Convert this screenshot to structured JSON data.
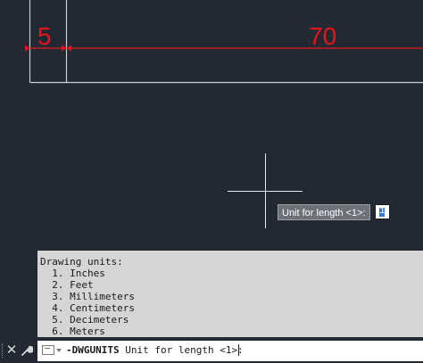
{
  "drawing": {
    "dim_left": "5",
    "dim_right": "70",
    "dim_color": "#e8141c",
    "line_color": "#c8ccd0",
    "background": "#222933"
  },
  "tooltip": {
    "text": "Unit for length <1>:"
  },
  "dynamic_input": {
    "value": "1"
  },
  "history": {
    "lines": [
      "Drawing units:",
      "  1. Inches",
      "  2. Feet",
      "  3. Millimeters",
      "  4. Centimeters",
      "  5. Decimeters",
      "  6. Meters"
    ]
  },
  "command_line": {
    "command": "-DWGUNITS",
    "prompt": " Unit for length <1>: "
  },
  "icons": {
    "close": "close-icon",
    "customize": "wrench-icon",
    "prompt": "command-prompt-icon"
  }
}
